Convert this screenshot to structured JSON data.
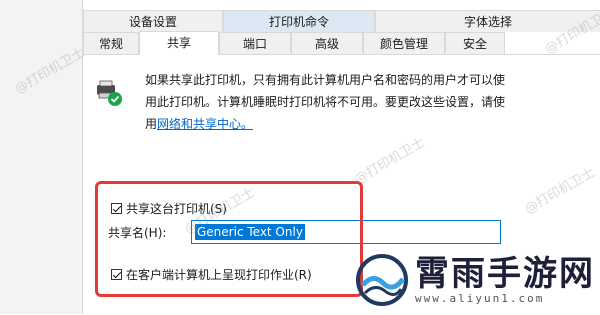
{
  "tabs_top": [
    {
      "label": "设备设置"
    },
    {
      "label": "打印机命令"
    },
    {
      "label": "字体选择"
    }
  ],
  "tabs_bottom": [
    {
      "label": "常规"
    },
    {
      "label": "共享"
    },
    {
      "label": "端口"
    },
    {
      "label": "高级"
    },
    {
      "label": "颜色管理"
    },
    {
      "label": "安全"
    }
  ],
  "sharing": {
    "description_part1": "如果共享此打印机，只有拥有此计算机用户名和密码的用户才可以使",
    "description_part2": "用此打印机。计算机睡眠时打印机将不可用。要更改这些设置，请使",
    "description_part3": "用",
    "network_link": "网络和共享中心。",
    "share_checkbox_label": "共享这台打印机(S)",
    "share_name_label": "共享名(H):",
    "share_name_value": "Generic  Text Only",
    "render_jobs_label": "在客户端计算机上呈现打印作业(R)"
  },
  "watermark_text": "@打印机卫士",
  "logo": {
    "brand": "霄雨手游网",
    "url": "www.aliyun1.com"
  }
}
